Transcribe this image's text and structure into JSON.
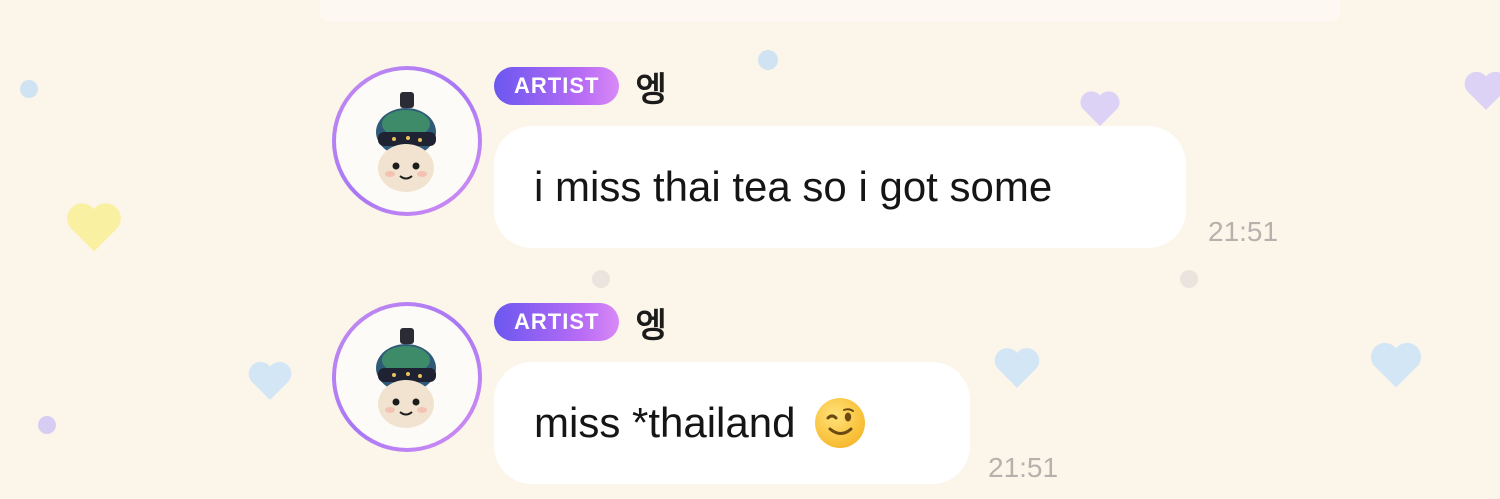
{
  "messages": [
    {
      "badge": "ARTIST",
      "sender": "엥",
      "text": "i miss thai tea so i got some",
      "time": "21:51"
    },
    {
      "badge": "ARTIST",
      "sender": "엥",
      "text": "miss *thailand",
      "emoji": "winking-face",
      "time": "21:51"
    }
  ],
  "colors": {
    "background": "#fcf5ea",
    "badge_gradient_start": "#6b57f0",
    "badge_gradient_end": "#d989f7",
    "bubble": "#ffffff",
    "timestamp": "#b5b1ad"
  }
}
